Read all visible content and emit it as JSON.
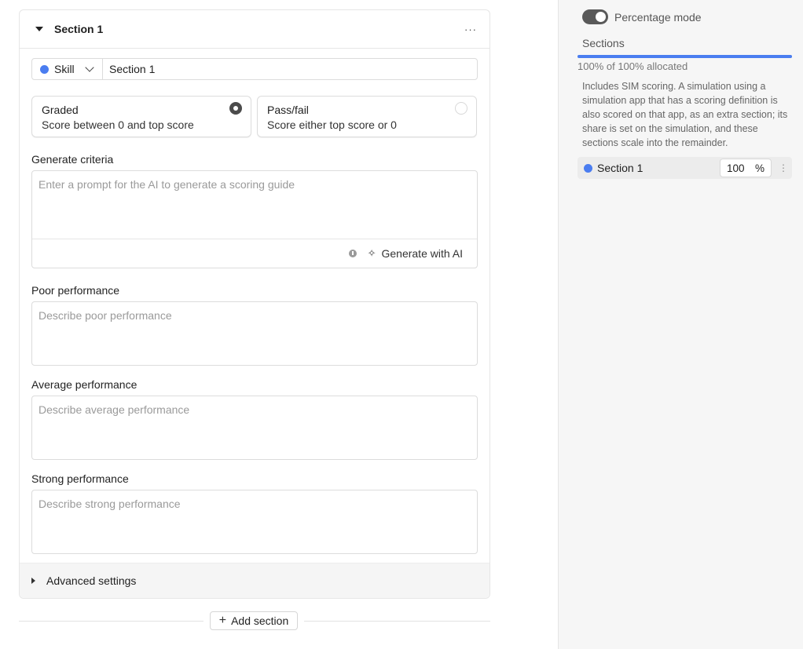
{
  "section": {
    "title": "Section 1",
    "more_label": "···",
    "type_select": "Skill",
    "name_value": "Section 1"
  },
  "scoring_options": [
    {
      "title": "Graded",
      "subtitle": "Score between 0 and top score",
      "selected": true
    },
    {
      "title": "Pass/fail",
      "subtitle": "Score either top score or 0",
      "selected": false
    }
  ],
  "generate": {
    "label": "Generate criteria",
    "placeholder": "Enter a prompt for the AI to generate a scoring guide",
    "button": "Generate with AI",
    "sparkle_icon": "✧"
  },
  "performance": {
    "poor_label": "Poor performance",
    "poor_placeholder": "Describe poor performance",
    "average_label": "Average performance",
    "average_placeholder": "Describe average performance",
    "strong_label": "Strong performance",
    "strong_placeholder": "Describe strong performance"
  },
  "advanced_label": "Advanced settings",
  "add_section": {
    "plus": "+",
    "label": "Add section"
  },
  "sidebar": {
    "toggle_label": "Percentage mode",
    "toggle_on": true,
    "sections_title": "Sections",
    "allocated_percent": 100,
    "allocated_text": "100% of 100% allocated",
    "description": "Includes SIM scoring. A simulation using a simulation app that has a scoring definition is also scored on that app, as an extra section; its share is set on the simulation, and these sections scale into the remainder.",
    "items": [
      {
        "label": "Section 1",
        "value": "100",
        "unit": "%",
        "menu": "⋮"
      }
    ]
  },
  "colors": {
    "accent": "#4a7df0",
    "toggle": "#595959",
    "sidebar_bg": "#f6f6f6"
  }
}
